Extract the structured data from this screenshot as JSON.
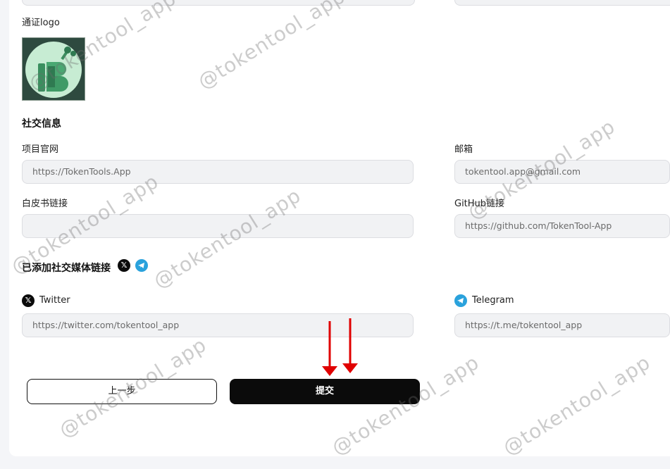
{
  "logo_section": {
    "label": "通证logo",
    "image_alt": "B logo"
  },
  "social_section": {
    "title": "社交信息",
    "website": {
      "label": "项目官网",
      "value": "https://TokenTools.App"
    },
    "email": {
      "label": "邮箱",
      "value": "tokentool.app@gmail.com"
    },
    "whitepaper": {
      "label": "白皮书链接",
      "value": ""
    },
    "github": {
      "label": "GitHub链接",
      "value": "https://github.com/TokenTool-App"
    }
  },
  "added_media": {
    "title": "已添加社交媒体链接",
    "icons": [
      "x-icon",
      "telegram-icon"
    ]
  },
  "twitter": {
    "label": "Twitter",
    "value": "https://twitter.com/tokentool_app"
  },
  "telegram": {
    "label": "Telegram",
    "value": "https://t.me/tokentool_app"
  },
  "buttons": {
    "prev": "上一步",
    "submit": "提交"
  },
  "watermark": "@tokentool_app",
  "colors": {
    "submit_bg": "#0b0b0b",
    "telegram": "#2aa2dc",
    "arrow": "#e00000"
  }
}
